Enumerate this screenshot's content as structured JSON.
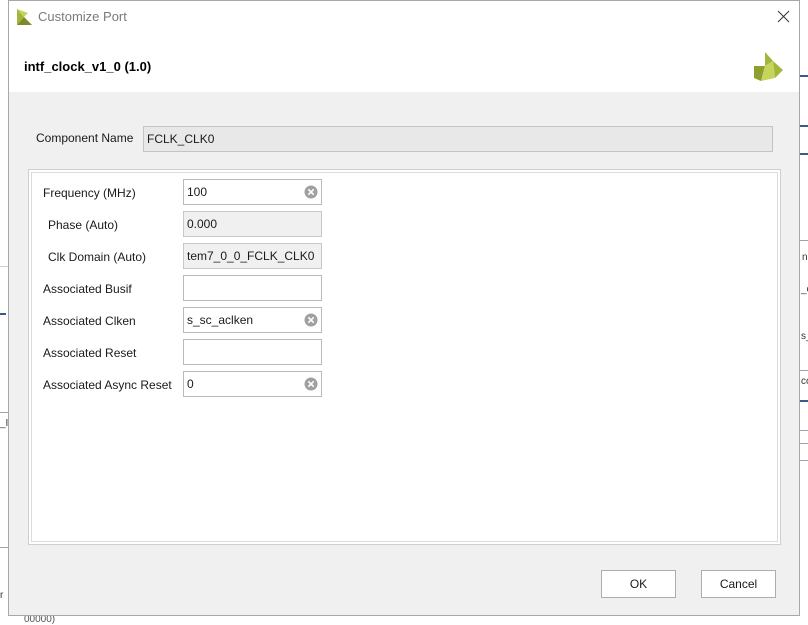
{
  "window": {
    "title": "Customize Port"
  },
  "header": {
    "title": "intf_clock_v1_0 (1.0)"
  },
  "component": {
    "label": "Component Name",
    "value": "FCLK_CLK0"
  },
  "params": [
    {
      "label": "Frequency (MHz)",
      "value": "100",
      "readonly": false,
      "clearable": true
    },
    {
      "label": "Phase (Auto)",
      "value": "0.000",
      "readonly": true,
      "clearable": false
    },
    {
      "label": "Clk Domain (Auto)",
      "value": "tem7_0_0_FCLK_CLK0",
      "readonly": true,
      "clearable": false
    },
    {
      "label": "Associated Busif",
      "value": "",
      "readonly": false,
      "clearable": false
    },
    {
      "label": "Associated Clken",
      "value": "s_sc_aclken",
      "readonly": false,
      "clearable": true
    },
    {
      "label": "Associated Reset",
      "value": "",
      "readonly": false,
      "clearable": false
    },
    {
      "label": "Associated Async Reset",
      "value": "0",
      "readonly": false,
      "clearable": true
    }
  ],
  "buttons": {
    "ok": "OK",
    "cancel": "Cancel"
  },
  "background_fragments": {
    "right_1": "n",
    "right_2": "_c",
    "right_3": "s_",
    "right_4": "cc",
    "left_1": "_I",
    "left_2": "r",
    "bottom": "00000)"
  },
  "colors": {
    "logo": "#a4b53a",
    "logo_dark": "#7d8b28",
    "clear_icon": "#a0a0a0",
    "dialog_bg": "#f0f0f0"
  },
  "icons": {
    "title": "vivado-logo-icon",
    "close": "close-icon",
    "header": "xilinx-logo-icon",
    "clear": "clear-icon"
  }
}
